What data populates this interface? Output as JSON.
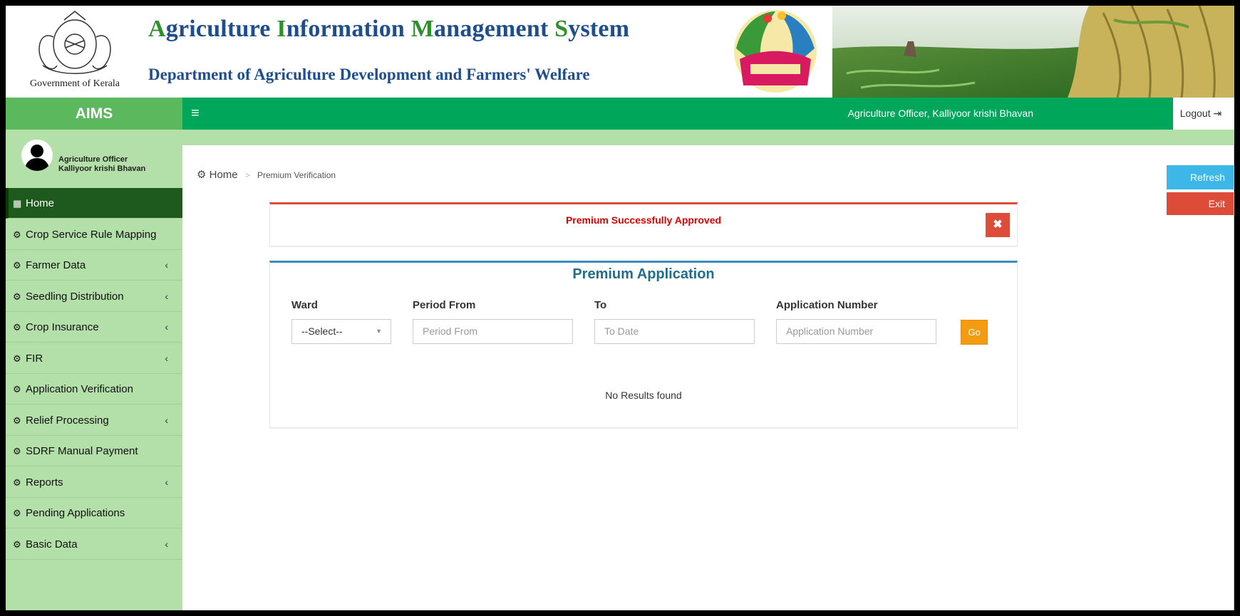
{
  "header": {
    "emblem_caption": "Government of Kerala",
    "title_parts": [
      "A",
      "griculture ",
      "I",
      "nformation ",
      "M",
      "anagement ",
      "S",
      "ystem"
    ],
    "subtitle": "Department of Agriculture Development and Farmers' Welfare"
  },
  "topbar": {
    "brand": "AIMS",
    "menu_toggle_icon": "≡",
    "user_label": "Agriculture Officer, Kalliyoor krishi Bhavan",
    "logout_label": "Logout"
  },
  "sidebar": {
    "user_role": "Agriculture Officer",
    "user_office": "Kalliyoor krishi Bhavan",
    "items": [
      {
        "label": "Home",
        "icon": "grid-icon",
        "active": true,
        "has_submenu": false
      },
      {
        "label": "Crop Service Rule Mapping",
        "icon": "dashboard-icon",
        "active": false,
        "has_submenu": false
      },
      {
        "label": "Farmer Data",
        "icon": "dashboard-icon",
        "active": false,
        "has_submenu": true
      },
      {
        "label": "Seedling Distribution",
        "icon": "dashboard-icon",
        "active": false,
        "has_submenu": true
      },
      {
        "label": "Crop Insurance",
        "icon": "dashboard-icon",
        "active": false,
        "has_submenu": true
      },
      {
        "label": "FIR",
        "icon": "dashboard-icon",
        "active": false,
        "has_submenu": true
      },
      {
        "label": "Application Verification",
        "icon": "dashboard-icon",
        "active": false,
        "has_submenu": false
      },
      {
        "label": "Relief Processing",
        "icon": "dashboard-icon",
        "active": false,
        "has_submenu": true
      },
      {
        "label": "SDRF Manual Payment",
        "icon": "dashboard-icon",
        "active": false,
        "has_submenu": false
      },
      {
        "label": "Reports",
        "icon": "dashboard-icon",
        "active": false,
        "has_submenu": true
      },
      {
        "label": "Pending Applications",
        "icon": "dashboard-icon",
        "active": false,
        "has_submenu": false
      },
      {
        "label": "Basic Data",
        "icon": "dashboard-icon",
        "active": false,
        "has_submenu": true
      }
    ]
  },
  "breadcrumb": {
    "home": "Home",
    "separator": ">",
    "current": "Premium Verification"
  },
  "side_buttons": {
    "refresh": "Refresh",
    "exit": "Exit"
  },
  "alert": {
    "message": "Premium Successfully Approved",
    "close_icon": "✖"
  },
  "form": {
    "title": "Premium Application",
    "ward_label": "Ward",
    "ward_value": "--Select--",
    "period_from_label": "Period From",
    "period_from_placeholder": "Period From",
    "to_label": "To",
    "to_placeholder": "To Date",
    "app_number_label": "Application Number",
    "app_number_placeholder": "Application Number",
    "go_label": "Go",
    "empty_message": "No Results found"
  },
  "colors": {
    "topbar": "#00a65a",
    "brand": "#5cb85c",
    "sidebar": "#b3dfa8",
    "active_item": "#1e5a1e",
    "danger": "#dd4b39",
    "info": "#3cb7e8",
    "warning": "#f39c12",
    "title_blue": "#1f4e8c"
  }
}
